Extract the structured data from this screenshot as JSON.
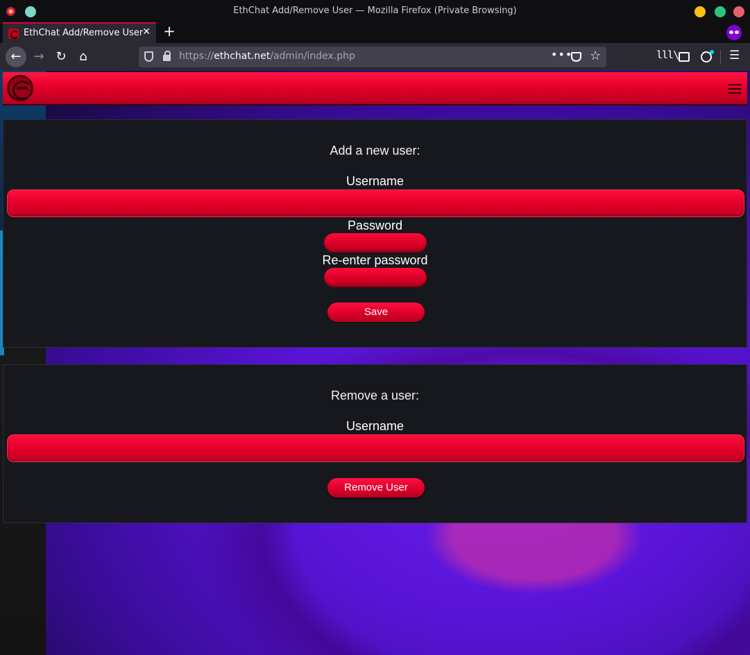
{
  "window": {
    "title": "EthChat Add/Remove User — Mozilla Firefox (Private Browsing)"
  },
  "tab": {
    "label": "EthChat Add/Remove User",
    "close_glyph": "✕",
    "new_tab_glyph": "+"
  },
  "toolbar": {
    "back_glyph": "←",
    "forward_glyph": "→",
    "reload_glyph": "↻",
    "home_glyph": "⌂",
    "url_prefix": "https://",
    "url_host": "ethchat.net",
    "url_path": "/admin/index.php",
    "more_glyph": "•••",
    "star_glyph": "☆",
    "library_glyph": "lll\\",
    "menu_glyph": "☰"
  },
  "icons": {
    "site_logo": "ethchat-logo-icon",
    "hamburger": "hamburger-menu-icon",
    "private_browsing": "private-browsing-mask-icon"
  },
  "colors": {
    "accent_red": "#e8002c",
    "card_bg": "#16181d",
    "firefox_toolbar": "#2b2a33"
  },
  "add_user": {
    "heading": "Add a new user:",
    "username_label": "Username",
    "username_value": "",
    "password_label": "Password",
    "password_value": "",
    "reenter_label": "Re-enter password",
    "reenter_value": "",
    "save_label": "Save"
  },
  "remove_user": {
    "heading": "Remove a user:",
    "username_label": "Username",
    "username_value": "",
    "remove_label": "Remove User"
  }
}
